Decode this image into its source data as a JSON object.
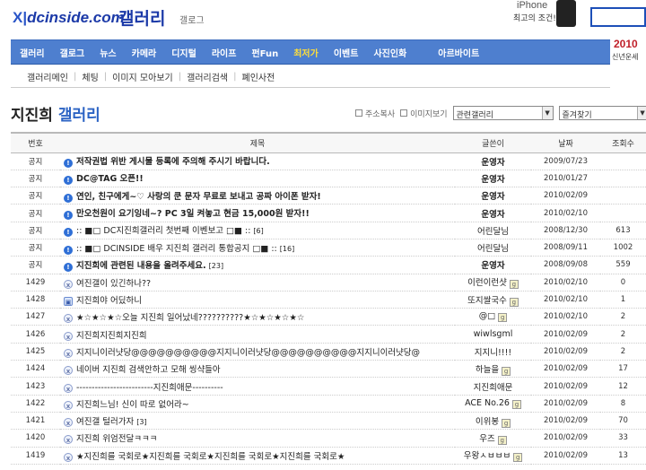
{
  "header": {
    "logo_mark": "X|",
    "logo_text": "dcinside.com",
    "gallery_title": "갤러리",
    "gallog": "갤로그",
    "promo_product": "iPhone",
    "promo_text": "최고의 조건!"
  },
  "nav": {
    "items": [
      {
        "label": "갤러리",
        "hi": false
      },
      {
        "label": "갤로그",
        "hi": false
      },
      {
        "label": "뉴스",
        "hi": false
      },
      {
        "label": "카메라",
        "hi": false
      },
      {
        "label": "디지털",
        "hi": false
      },
      {
        "label": "라이프",
        "hi": false
      },
      {
        "label": "펀Fun",
        "hi": false
      },
      {
        "label": "최저가",
        "hi": true
      },
      {
        "label": "이벤트",
        "hi": false
      },
      {
        "label": "사진인화",
        "hi": false
      },
      {
        "label": "아르바이트",
        "hi": false
      }
    ]
  },
  "banner": {
    "year": "2010",
    "text": "신년운세"
  },
  "subnav": {
    "items": [
      "갤러리메인",
      "체팅",
      "이미지 모아보기",
      "갤러리검색",
      "폐인사전"
    ]
  },
  "page": {
    "title_name": "지진희",
    "title_suffix": "갤러리"
  },
  "tools": {
    "address_copy": "주소복사",
    "image_view": "이미지보기",
    "related_select": "관련갤러리",
    "favorites_select": "즐겨찾기"
  },
  "table": {
    "headers": {
      "no": "번호",
      "title": "제목",
      "author": "글쓴이",
      "date": "날짜",
      "views": "조회수"
    },
    "rows": [
      {
        "no": "공지",
        "icon": "notice",
        "title": "저작권법 위반 게시물 등록에 주의해 주시기 바랍니다.",
        "count": "",
        "author": "운영자",
        "gl": false,
        "date": "2009/07/23",
        "views": ""
      },
      {
        "no": "공지",
        "icon": "notice",
        "title": "DC@TAG 오픈!!",
        "count": "",
        "author": "운영자",
        "gl": false,
        "date": "2010/01/27",
        "views": ""
      },
      {
        "no": "공지",
        "icon": "notice",
        "title": "연인, 친구에게~♡ 사랑의 쿤 문자 무료로 보내고 공짜 아이폰 받자!",
        "count": "",
        "author": "운영자",
        "gl": false,
        "date": "2010/02/09",
        "views": ""
      },
      {
        "no": "공지",
        "icon": "notice",
        "title": "만오천원이 요기잉네~? PC 3일 켜놓고 현금 15,000원 받자!!",
        "count": "",
        "author": "운영자",
        "gl": false,
        "date": "2010/02/10",
        "views": ""
      },
      {
        "no": "공지",
        "icon": "notice",
        "title": ":: ■□ DC지진희갤러리 첫번째 이벤보고 □■ ::",
        "count": "[6]",
        "author": "어린달님",
        "gl": false,
        "date": "2008/12/30",
        "views": "613",
        "light": true
      },
      {
        "no": "공지",
        "icon": "notice",
        "title": ":: ■□ DCINSIDE 배우 지진희 갤러리 통합공지 □■ ::",
        "count": "[16]",
        "author": "어린달님",
        "gl": false,
        "date": "2008/09/11",
        "views": "1002",
        "light": true
      },
      {
        "no": "공지",
        "icon": "notice",
        "title": "지진희에 관련된 내용을 올려주세요.",
        "count": "[23]",
        "author": "운영자",
        "gl": false,
        "date": "2008/09/08",
        "views": "559"
      },
      {
        "no": "1429",
        "icon": "text",
        "title": "여진갤이 있긴하나??",
        "count": "",
        "author": "이런이런샷",
        "gl": true,
        "date": "2010/02/10",
        "views": "0"
      },
      {
        "no": "1428",
        "icon": "img",
        "title": "지진희야 어딨하니",
        "count": "",
        "author": "또지쌀국수",
        "gl": true,
        "date": "2010/02/10",
        "views": "1"
      },
      {
        "no": "1427",
        "icon": "text",
        "title": "★☆★☆★☆오늘 지진희 일어났네??????????★☆★☆★☆★☆",
        "count": "",
        "author": "@□",
        "gl": true,
        "date": "2010/02/10",
        "views": "2"
      },
      {
        "no": "1426",
        "icon": "text",
        "title": "지진희지진희지진희",
        "count": "",
        "author": "wiwlsgml",
        "gl": false,
        "date": "2010/02/09",
        "views": "2"
      },
      {
        "no": "1425",
        "icon": "text",
        "title": "지지니이러냣당@@@@@@@@@@지지니이러냣당@@@@@@@@@@지지니이러냣당@",
        "count": "",
        "author": "지지니!!!!",
        "gl": false,
        "date": "2010/02/09",
        "views": "2"
      },
      {
        "no": "1424",
        "icon": "text",
        "title": "네이버 지진희 검색안하고 모해 씽샥들아",
        "count": "",
        "author": "하늘을",
        "gl": true,
        "date": "2010/02/09",
        "views": "17"
      },
      {
        "no": "1423",
        "icon": "text",
        "title": "-------------------------지진희애문----------",
        "count": "",
        "author": "지진희애문",
        "gl": false,
        "date": "2010/02/09",
        "views": "12"
      },
      {
        "no": "1422",
        "icon": "text",
        "title": "지진희느님! 신이 따로 없어라~",
        "count": "",
        "author": "ACE No.26",
        "gl": true,
        "date": "2010/02/09",
        "views": "8"
      },
      {
        "no": "1421",
        "icon": "text",
        "title": "여진갤 털러가자",
        "count": "[3]",
        "author": "이위봉",
        "gl": true,
        "date": "2010/02/09",
        "views": "70"
      },
      {
        "no": "1420",
        "icon": "text",
        "title": "지진희 위엄전달ㅋㅋㅋ",
        "count": "",
        "author": "우즈",
        "gl": true,
        "date": "2010/02/09",
        "views": "33"
      },
      {
        "no": "1419",
        "icon": "text",
        "title": "★지진희를 국회로★지진희를 국회로★지진희를 국회로★지진희를 국회로★",
        "count": "",
        "author": "우왕ㅅㅂㅂㅂ",
        "gl": true,
        "date": "2010/02/09",
        "views": "13"
      }
    ]
  }
}
